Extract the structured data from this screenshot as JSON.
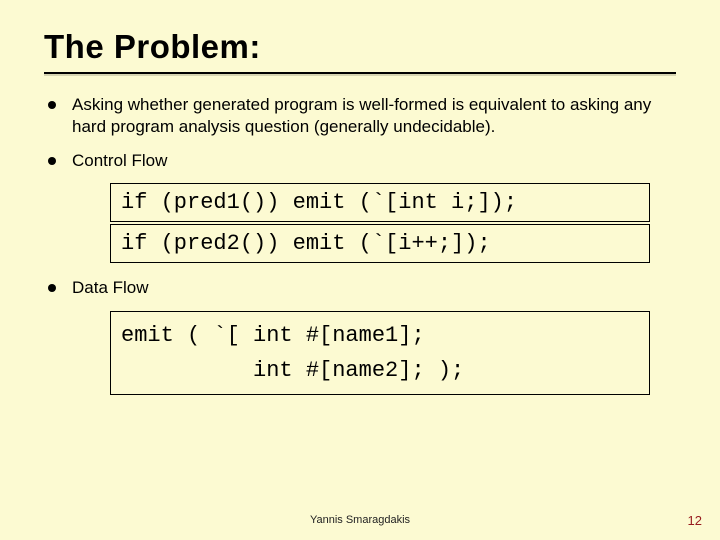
{
  "title": "The Problem:",
  "bullets": {
    "b1": "Asking whether generated program is well-formed is equivalent to asking any hard program analysis question (generally undecidable).",
    "b2": "Control Flow",
    "b3": "Data Flow"
  },
  "code": {
    "cf1": "if (pred1()) emit (`[int i;]);",
    "cf2": "if (pred2()) emit (`[i++;]);",
    "df": "emit ( `[ int #[name1];\n          int #[name2]; );"
  },
  "footer": {
    "author": "Yannis Smaragdakis",
    "page": "12"
  }
}
